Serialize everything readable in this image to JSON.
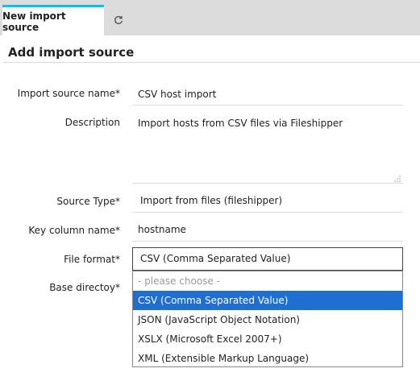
{
  "tabs": {
    "active_label": "New import source",
    "refresh_icon": "refresh-icon"
  },
  "page": {
    "title": "Add import source"
  },
  "form": {
    "import_source_name": {
      "label": "Import source name*",
      "value": "CSV host import"
    },
    "description": {
      "label": "Description",
      "value": "Import hosts from CSV files via Fileshipper"
    },
    "source_type": {
      "label": "Source Type*",
      "value": "Import from files (fileshipper)"
    },
    "key_column_name": {
      "label": "Key column name*",
      "value": "hostname"
    },
    "file_format": {
      "label": "File format*",
      "value": "CSV (Comma Separated Value)",
      "options": [
        "- please choose -",
        "CSV (Comma Separated Value)",
        "JSON (JavaScript Object Notation)",
        "XSLX (Microsoft Excel 2007+)",
        "XML (Extensible Markup Language)"
      ],
      "selected_index": 1
    },
    "base_directory": {
      "label": "Base directoy*"
    }
  },
  "colors": {
    "tab_accent": "#00c3ed",
    "selected_option": "#1e6fd1",
    "tabbar_background": "#dcdcdc"
  }
}
